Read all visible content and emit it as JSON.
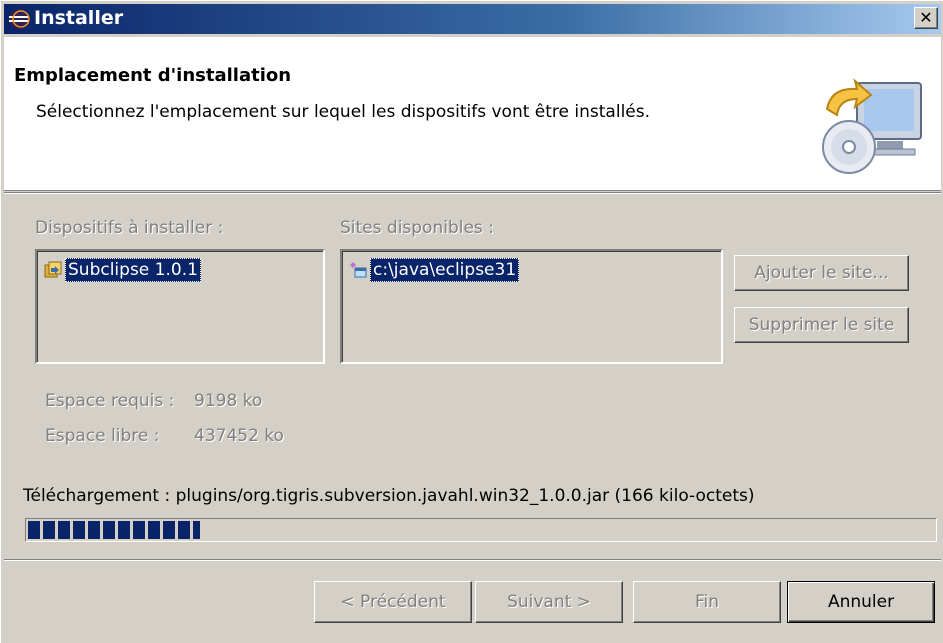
{
  "window": {
    "title": "Installer",
    "close_label": "✕"
  },
  "banner": {
    "heading": "Emplacement d'installation",
    "description": "Sélectionnez l'emplacement sur lequel les dispositifs vont être installés."
  },
  "features": {
    "label": "Dispositifs à installer :",
    "items": [
      {
        "label": "Subclipse 1.0.1",
        "icon": "feature-icon",
        "selected": true
      }
    ]
  },
  "sites": {
    "label": "Sites disponibles :",
    "items": [
      {
        "label": "c:\\java\\eclipse31",
        "icon": "site-icon",
        "selected": true
      }
    ],
    "add_button": "Ajouter le site...",
    "remove_button": "Supprimer le site"
  },
  "space": {
    "required_label": "Espace requis :",
    "required_value": "9198 ko",
    "free_label": "Espace libre :",
    "free_value": "437452 ko"
  },
  "download": {
    "status": "Téléchargement : plugins/org.tigris.subversion.javahl.win32_1.0.0.jar (166 kilo-octets)",
    "progress": 0.19
  },
  "footer": {
    "back_button": "< Précédent",
    "next_button": "Suivant >",
    "finish_button": "Fin",
    "cancel_button": "Annuler"
  },
  "colors": {
    "selection": "#0a246a",
    "face": "#d4d0c8",
    "disabled_text": "#808080"
  }
}
